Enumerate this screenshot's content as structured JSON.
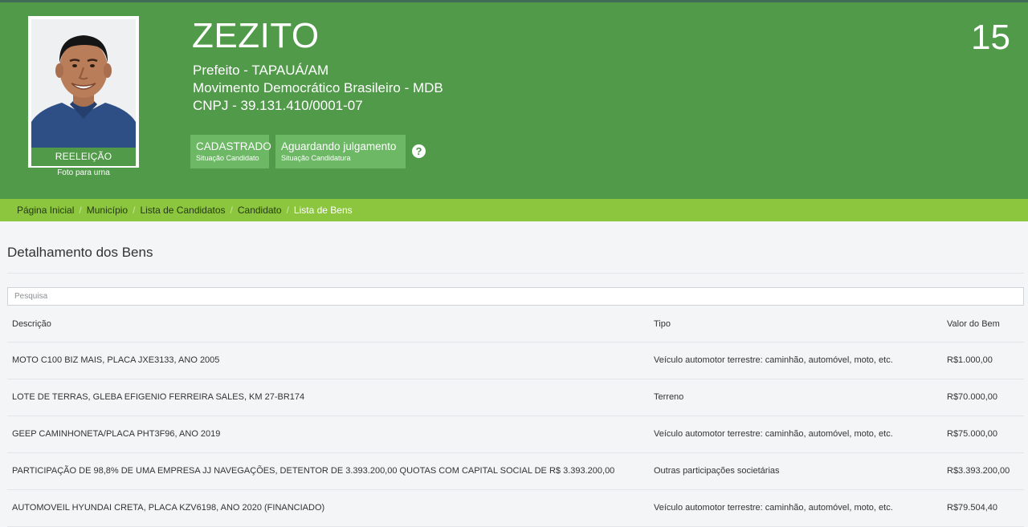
{
  "candidate": {
    "name": "ZEZITO",
    "number": "15",
    "role": "Prefeito - TAPAUÁ/AM",
    "party": "Movimento Democrático Brasileiro - MDB",
    "cnpj": "CNPJ - 39.131.410/0001-07",
    "photo_badge": "REELEIÇÃO",
    "photo_caption": "Foto para urna",
    "status_candidate": {
      "main": "CADASTRADO",
      "sub": "Situação Candidato"
    },
    "status_candidacy": {
      "main": "Aguardando julgamento",
      "sub": "Situação Candidatura"
    },
    "help_glyph": "?"
  },
  "breadcrumb": {
    "items": [
      "Página Inicial",
      "Município",
      "Lista de Candidatos",
      "Candidato",
      "Lista de Bens"
    ],
    "separator": "/"
  },
  "section": {
    "title": "Detalhamento dos Bens"
  },
  "search": {
    "placeholder": "Pesquisa",
    "value": ""
  },
  "table": {
    "headers": [
      "Descrição",
      "Tipo",
      "Valor do Bem"
    ],
    "rows": [
      [
        "MOTO C100 BIZ MAIS, PLACA JXE3133, ANO 2005",
        "Veículo automotor terrestre: caminhão, automóvel, moto, etc.",
        "R$1.000,00"
      ],
      [
        "LOTE DE TERRAS, GLEBA EFIGENIO FERREIRA SALES, KM 27-BR174",
        "Terreno",
        "R$70.000,00"
      ],
      [
        "GEEP CAMINHONETA/PLACA PHT3F96, ANO 2019",
        "Veículo automotor terrestre: caminhão, automóvel, moto, etc.",
        "R$75.000,00"
      ],
      [
        "PARTICIPAÇÃO DE 98,8% DE UMA EMPRESA JJ NAVEGAÇÕES, DETENTOR DE 3.393.200,00 QUOTAS COM CAPITAL SOCIAL DE R$ 3.393.200,00",
        "Outras participações societárias",
        "R$3.393.200,00"
      ],
      [
        "AUTOMOVEIL HYUNDAI CRETA, PLACA KZV6198, ANO 2020 (FINANCIADO)",
        "Veículo automotor terrestre: caminhão, automóvel, moto, etc.",
        "R$79.504,40"
      ]
    ]
  },
  "colors": {
    "header_green": "#519a4a",
    "status_green": "#6cb865",
    "breadcrumb_lime": "#8cc63f",
    "page_background": "#f4f5f7"
  }
}
